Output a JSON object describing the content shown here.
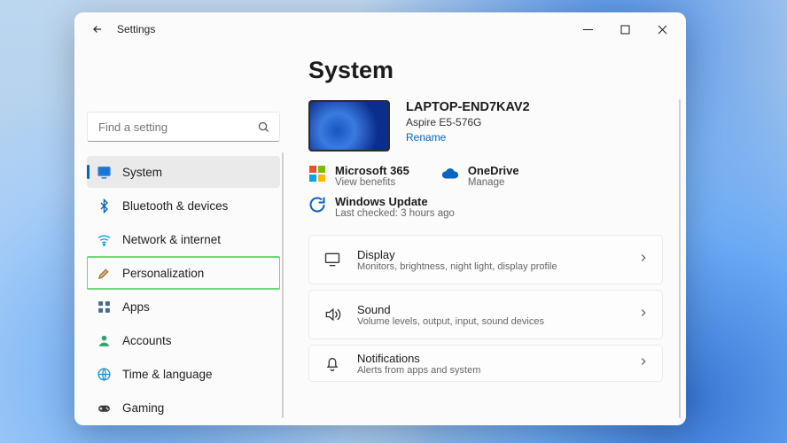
{
  "titlebar": {
    "title": "Settings"
  },
  "search": {
    "placeholder": "Find a setting"
  },
  "sidebar": {
    "items": [
      {
        "label": "System",
        "icon": "system",
        "selected": true,
        "highlight": false
      },
      {
        "label": "Bluetooth & devices",
        "icon": "bluetooth",
        "selected": false,
        "highlight": false
      },
      {
        "label": "Network & internet",
        "icon": "network",
        "selected": false,
        "highlight": false
      },
      {
        "label": "Personalization",
        "icon": "personalization",
        "selected": false,
        "highlight": true
      },
      {
        "label": "Apps",
        "icon": "apps",
        "selected": false,
        "highlight": false
      },
      {
        "label": "Accounts",
        "icon": "accounts",
        "selected": false,
        "highlight": false
      },
      {
        "label": "Time & language",
        "icon": "time-language",
        "selected": false,
        "highlight": false
      },
      {
        "label": "Gaming",
        "icon": "gaming",
        "selected": false,
        "highlight": false
      }
    ]
  },
  "main": {
    "heading": "System",
    "device": {
      "name": "LAPTOP-END7KAV2",
      "model": "Aspire E5-576G",
      "rename_label": "Rename"
    },
    "services": {
      "microsoft365": {
        "name": "Microsoft 365",
        "sub": "View benefits"
      },
      "onedrive": {
        "name": "OneDrive",
        "sub": "Manage"
      }
    },
    "update": {
      "name": "Windows Update",
      "sub": "Last checked: 3 hours ago"
    },
    "cards": [
      {
        "key": "display",
        "title": "Display",
        "sub": "Monitors, brightness, night light, display profile"
      },
      {
        "key": "sound",
        "title": "Sound",
        "sub": "Volume levels, output, input, sound devices"
      },
      {
        "key": "notifications",
        "title": "Notifications",
        "sub": "Alerts from apps and system"
      }
    ]
  },
  "icons": {
    "system": "system-icon",
    "bluetooth": "bluetooth-icon",
    "network": "wifi-icon",
    "personalization": "paintbrush-icon",
    "apps": "apps-icon",
    "accounts": "person-icon",
    "time-language": "globe-icon",
    "gaming": "gamepad-icon"
  }
}
